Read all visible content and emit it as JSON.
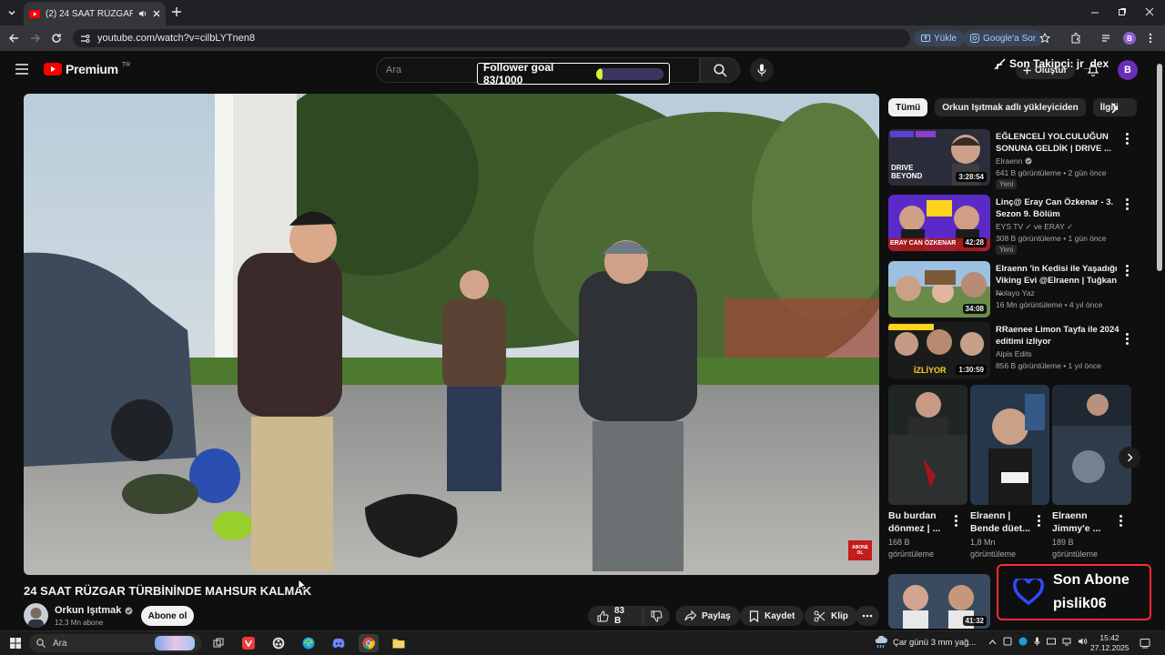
{
  "browser": {
    "tab_title": "(2) 24 SAAT RÜZGAR TÜRBİ",
    "url": "youtube.com/watch?v=cilbLYTnen8",
    "yukle_label": "Yükle",
    "google_sor_label": "Google'a Sor",
    "profile_initial": "B"
  },
  "header": {
    "logo_text": "Premium",
    "logo_badge": "TR",
    "search_placeholder": "Ara",
    "create_label": "Oluştur",
    "avatar_initial": "B"
  },
  "overlay": {
    "follower_goal_text": "Follower goal 83/1000",
    "follower_goal_progress": 0.083,
    "last_follower_text": "Son Takipçi: jr_dex",
    "last_sub_label": "Son Abone",
    "last_sub_name": "pislik06"
  },
  "video": {
    "title": "24 SAAT RÜZGAR TÜRBİNİNDE MAHSUR KALMAK",
    "channel_name": "Orkun Işıtmak",
    "subscribers": "12,3 Mn abone",
    "subscribe_label": "Abone ol",
    "likes": "83 B",
    "share_label": "Paylaş",
    "save_label": "Kaydet",
    "clip_label": "Klip",
    "watermark": "ABONE OL"
  },
  "chips": [
    "Tümü",
    "Orkun Işıtmak adlı yükleyiciden",
    "İlgili"
  ],
  "recommendations": [
    {
      "title": "EĞLENCELİ YOLCULUĞUN SONUNA GELDİK | DRIVE ...",
      "channel": "Elraenn",
      "meta": "641 B görüntüleme • 2 gün önce",
      "badge": "Yeni",
      "duration": "3:28:54",
      "thumb_text": "DRIVE BEYOND"
    },
    {
      "title": "Linç@ Eray Can Özkenar - 3. Sezon 9. Bölüm",
      "channel": "EYS TV ✓ ve ERAY ✓",
      "meta": "308 B görüntüleme • 1 gün önce",
      "badge": "Yeni",
      "duration": "42:28",
      "thumb_text": "ERAY CAN ÖZKENAR"
    },
    {
      "title": "Elraenn 'in Kedisi ile Yaşadığı Viking Evi @Elraenn  | Tuğkan ...",
      "channel": "Nolayo Yaz",
      "meta": "16 Mn görüntüleme • 4 yıl önce",
      "badge": "",
      "duration": "34:08",
      "thumb_text": ""
    },
    {
      "title": "RRaenee Limon Tayfa ile 2024 editimi izliyor",
      "channel": "Alpis Edits",
      "meta": "856 B görüntüleme • 1 yıl önce",
      "badge": "",
      "duration": "1:30:59",
      "thumb_text": "İZLİYOR"
    }
  ],
  "shorts": [
    {
      "title": "Bu burdan dönmez | ...",
      "views": "168 B görüntüleme"
    },
    {
      "title": "Elraenn | Bende düet...",
      "views": "1,8 Mn görüntüleme"
    },
    {
      "title": "Elraenn Jimmy'e ...",
      "views": "189 B görüntüleme"
    }
  ],
  "last_rec_duration": "41:32",
  "taskbar": {
    "search_label": "Ara",
    "weather": "Çar günü 3 mm yağ...",
    "time": "15:42",
    "date": "27.12.2025"
  },
  "colors": {
    "youtube_red": "#ff0000",
    "goal_fill": "#d6f22b",
    "overlay_border": "#ff2b3a",
    "heart_blue": "#2d4bff"
  }
}
